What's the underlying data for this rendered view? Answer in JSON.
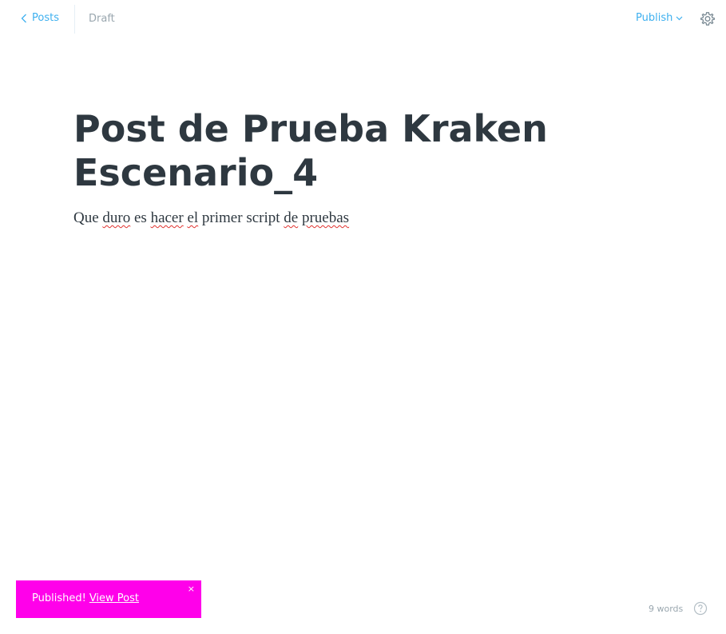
{
  "header": {
    "back_label": "Posts",
    "status": "Draft",
    "publish_label": "Publish"
  },
  "editor": {
    "title_line1": "Post de Prueba Kraken",
    "title_line2": "Escenario_4",
    "body_words": [
      "Que",
      "duro",
      "es",
      "hacer",
      "el",
      "primer",
      "script",
      "de",
      "pruebas"
    ]
  },
  "notification": {
    "message": "Published!",
    "link_label": "View Post",
    "close_glyph": "×"
  },
  "footer": {
    "word_count": "9 words"
  },
  "icons": {
    "back": "chevron-left-icon",
    "publish_dropdown": "chevron-down-icon",
    "settings": "gear-icon",
    "help": "question-circle-icon",
    "close": "close-icon"
  },
  "colors": {
    "accent": "#3eb0ef",
    "text": "#2e3840",
    "muted": "#9aa7af",
    "notification_bg": "#ff00ea",
    "spellcheck": "#e0312e"
  }
}
